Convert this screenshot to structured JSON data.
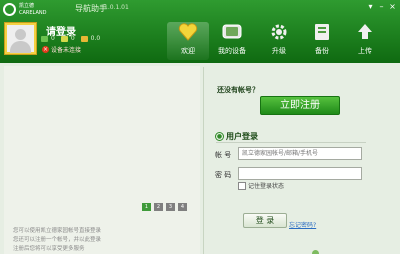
{
  "app": {
    "brand_cn": "凯立德",
    "brand_en": "CARELAND",
    "title": "导航助手",
    "version": "1.0.1.01",
    "accent": "#2a8d26"
  },
  "window_controls": {
    "skin": "▾",
    "minimize": "–",
    "close": "×"
  },
  "user": {
    "name": "请登录",
    "stats": [
      "0",
      "0",
      "0.0"
    ],
    "status": "设备未连接"
  },
  "nav": [
    {
      "label": "欢迎",
      "icon": "heart-icon"
    },
    {
      "label": "我的设备",
      "icon": "device-icon"
    },
    {
      "label": "升级",
      "icon": "upgrade-icon"
    },
    {
      "label": "备份",
      "icon": "backup-icon"
    },
    {
      "label": "上传",
      "icon": "upload-icon"
    }
  ],
  "carousel": {
    "pages": [
      "1",
      "2",
      "3",
      "4"
    ],
    "current": 1
  },
  "promo": {
    "line1": "您可以使用凯立德家园帐号直接登录",
    "line2": "您还可以注册一个帐号，并以此登录",
    "line3": "注册后您将可以享受更多服务"
  },
  "register": {
    "prompt": "还没有帐号？",
    "button": "立即注册"
  },
  "login": {
    "title": "用户登录",
    "account_label": "帐 号",
    "account_placeholder": "凯立德家园帐号/邮箱/手机号",
    "password_label": "密 码",
    "password_value": "",
    "remember": "记住登录状态",
    "submit": "登 录",
    "forgot": "忘记密码?"
  }
}
